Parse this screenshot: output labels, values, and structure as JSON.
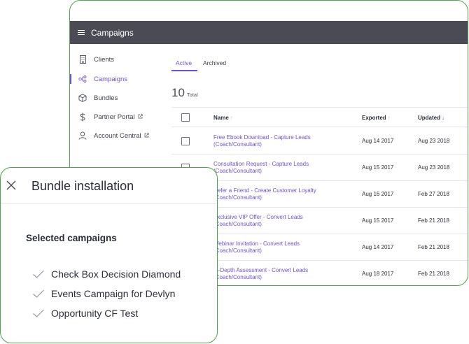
{
  "app": {
    "title": "Campaigns",
    "sidebar": {
      "items": [
        {
          "label": "Clients",
          "icon": "building-icon",
          "external": false
        },
        {
          "label": "Campaigns",
          "icon": "flow-icon",
          "external": false,
          "active": true
        },
        {
          "label": "Bundles",
          "icon": "box-icon",
          "external": false
        },
        {
          "label": "Partner Portal",
          "icon": "dollar-icon",
          "external": true
        },
        {
          "label": "Account Central",
          "icon": "user-icon",
          "external": true
        }
      ]
    },
    "tabs": [
      {
        "label": "Active",
        "active": true
      },
      {
        "label": "Archived",
        "active": false
      }
    ],
    "total": {
      "count": "10",
      "label": "Total"
    },
    "table": {
      "columns": {
        "name": "Name",
        "exported": "Exported",
        "updated": "Updated"
      },
      "rows": [
        {
          "name": "Free Ebook Download - Capture Leads (Coach/Consultant)",
          "exported": "Aug 14 2017",
          "updated": "Aug 23 2018"
        },
        {
          "name": "Consultation Request - Capture Leads (Coach/Consultant)",
          "exported": "Aug 15 2017",
          "updated": "Aug 23 2018"
        },
        {
          "name": "Refer a Friend - Create Customer Loyalty (Coach/Consultant)",
          "exported": "Aug 16 2017",
          "updated": "Feb 27 2018"
        },
        {
          "name": "Exclusive VIP Offer - Convert Leads (Coach/Consultant)",
          "exported": "Aug 15 2017",
          "updated": "Feb 21 2018"
        },
        {
          "name": "Webinar Invitation - Convert Leads (Coach/Consultant)",
          "exported": "Aug 14 2017",
          "updated": "Feb 21 2018"
        },
        {
          "name": "In-Depth Assessment - Convert Leads (Coach/Consultant)",
          "exported": "Aug 18 2017",
          "updated": "Feb 21 2018"
        }
      ]
    }
  },
  "modal": {
    "title": "Bundle installation",
    "subtitle": "Selected campaigns",
    "items": [
      {
        "label": "Check Box Decision Diamond"
      },
      {
        "label": "Events Campaign for Devlyn"
      },
      {
        "label": "Opportunity CF Test"
      }
    ]
  },
  "colors": {
    "accent": "#6e4fd3",
    "topbar": "#4a4b55",
    "frame_border": "#4ba745"
  }
}
